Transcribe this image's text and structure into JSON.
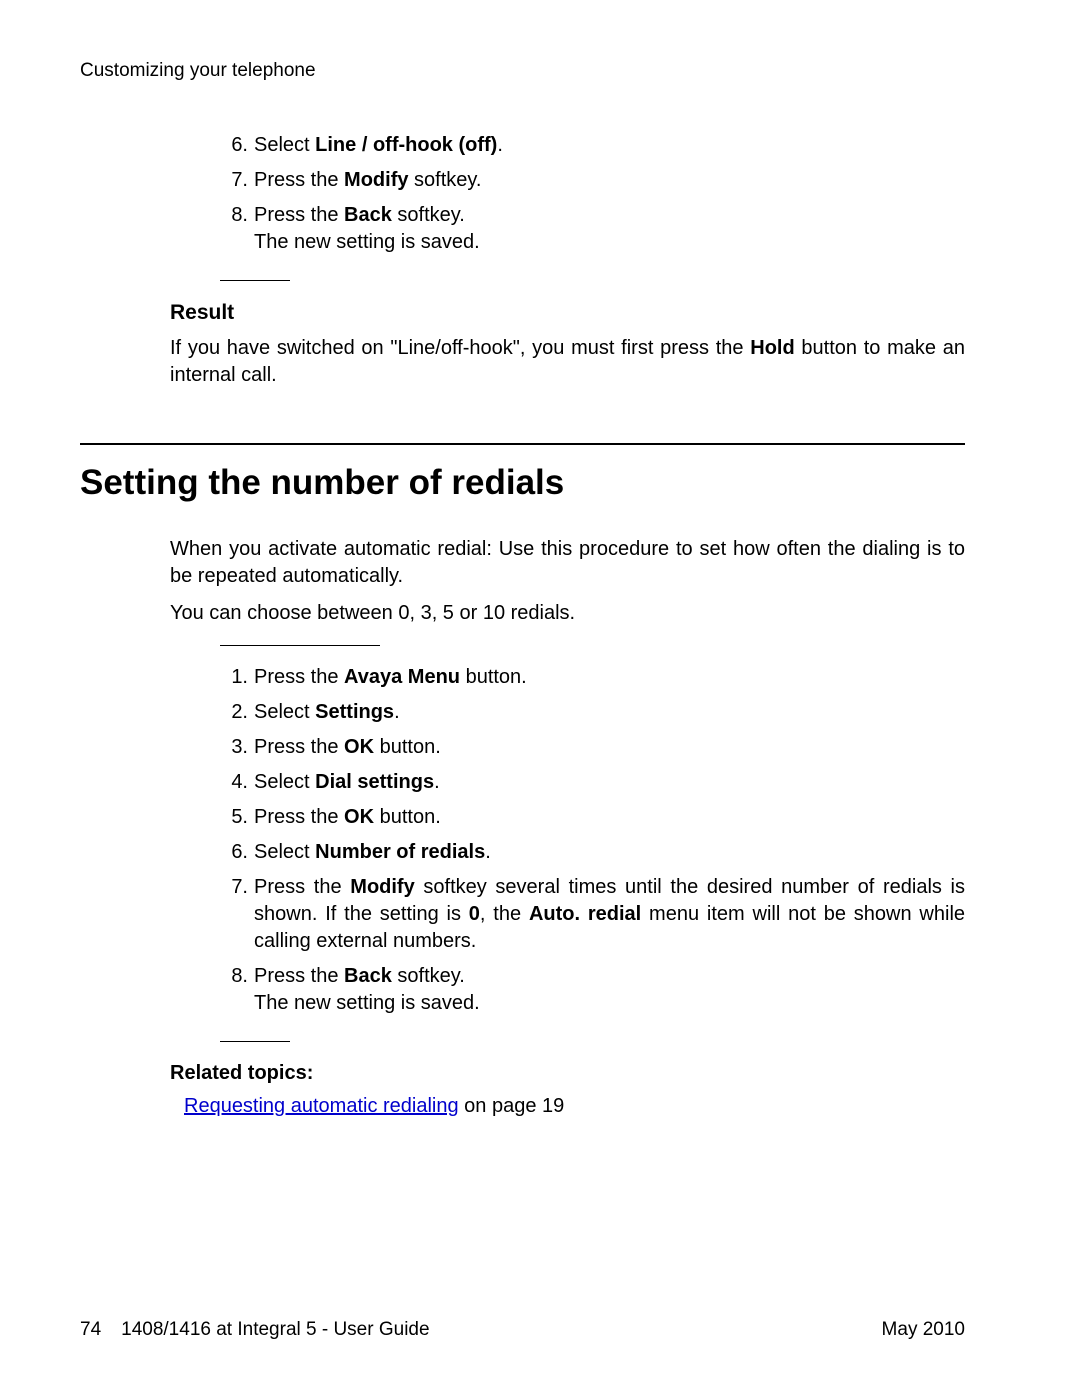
{
  "running_head": "Customizing your telephone",
  "top_steps": [
    {
      "n": "6.",
      "pre": "Select ",
      "bold": "Line / off-hook (off)",
      "post": "."
    },
    {
      "n": "7.",
      "pre": "Press the ",
      "bold": "Modify",
      "post": " softkey."
    },
    {
      "n": "8.",
      "pre": "Press the ",
      "bold": "Back",
      "post": " softkey.",
      "extra": "The new setting is saved."
    }
  ],
  "result": {
    "heading": "Result",
    "text_pre": "If you have switched on \"Line/off-hook\", you must first press the ",
    "text_bold": "Hold",
    "text_post": " button to make an internal call."
  },
  "section_title": "Setting the number of redials",
  "intro_1": "When you activate automatic redial: Use this procedure to set how often the dialing is to be repeated automatically.",
  "intro_2": "You can choose between 0, 3, 5 or 10 redials.",
  "main_steps": [
    {
      "n": "1.",
      "pre": "Press the ",
      "bold": "Avaya Menu",
      "post": " button."
    },
    {
      "n": "2.",
      "pre": "Select ",
      "bold": "Settings",
      "post": "."
    },
    {
      "n": "3.",
      "pre": "Press the ",
      "bold": "OK",
      "post": " button."
    },
    {
      "n": "4.",
      "pre": "Select ",
      "bold": "Dial settings",
      "post": "."
    },
    {
      "n": "5.",
      "pre": "Press the ",
      "bold": "OK",
      "post": " button."
    },
    {
      "n": "6.",
      "pre": "Select ",
      "bold": "Number of redials",
      "post": "."
    },
    {
      "n": "7.",
      "pre": "Press the ",
      "bold": "Modify",
      "post": " softkey several times until the desired number of redials is shown.",
      "line2_pre": "If the setting is ",
      "line2_b1": "0",
      "line2_mid": ", the ",
      "line2_b2": "Auto. redial",
      "line2_post": " menu item will not be shown while calling external numbers."
    },
    {
      "n": "8.",
      "pre": "Press the ",
      "bold": "Back",
      "post": " softkey.",
      "extra": "The new setting is saved."
    }
  ],
  "related": {
    "heading": "Related topics:",
    "link_text": "Requesting automatic redialing",
    "after": " on page 19"
  },
  "footer": {
    "page_num": "74",
    "doc_title": "1408/1416 at Integral 5 - User Guide",
    "date": "May 2010"
  }
}
